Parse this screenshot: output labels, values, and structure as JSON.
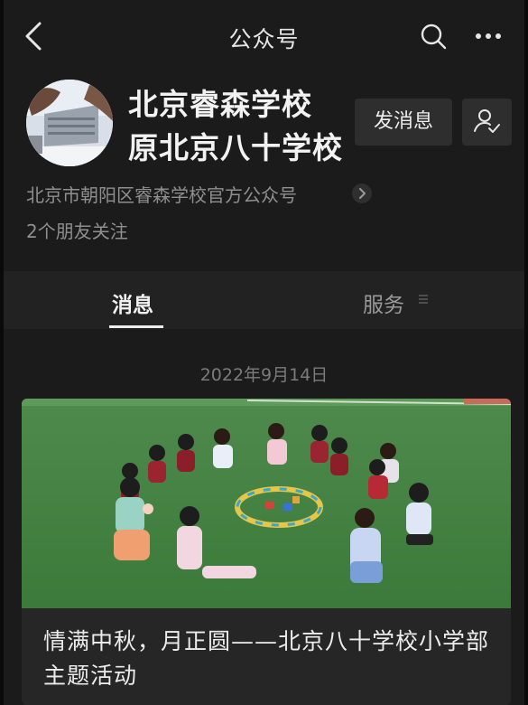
{
  "nav": {
    "title": "公众号",
    "back_icon": "chevron-left-icon",
    "search_icon": "search-icon",
    "more_icon": "more-dots-icon"
  },
  "profile": {
    "name_line1": "北京睿森学校",
    "name_line2": "原北京八十学校",
    "send_message_label": "发消息",
    "follow_icon": "person-check-icon",
    "description": "北京市朝阳区睿森学校官方公众号",
    "friends_following": "2个朋友关注"
  },
  "tabs": [
    {
      "label": "消息",
      "active": true
    },
    {
      "label": "服务",
      "active": false
    }
  ],
  "feed": {
    "date": "2022年9月14日",
    "article": {
      "title": "情满中秋，月正圆——北京八十学校小学部主题活动",
      "image": "children-sitting-in-circle-on-grass-photo"
    }
  },
  "colors": {
    "background": "#1b1b1b",
    "button_bg": "#2e2e2e",
    "text_primary": "#f2f2f2",
    "text_secondary": "#8f8f8f"
  }
}
